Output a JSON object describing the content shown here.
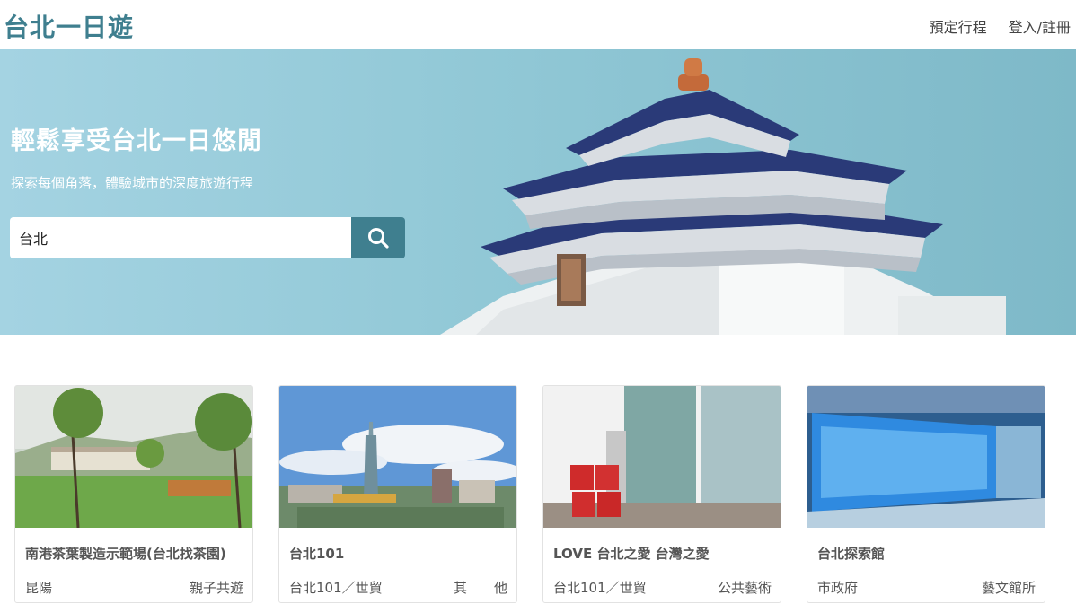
{
  "header": {
    "brand": "台北一日遊",
    "nav": {
      "booking": "預定行程",
      "login": "登入/註冊"
    }
  },
  "hero": {
    "title": "輕鬆享受台北一日悠閒",
    "subtitle": "探索每個角落，體驗城市的深度旅遊行程",
    "search": {
      "value": "台北",
      "icon": "search-icon"
    }
  },
  "cards": [
    {
      "title": "南港茶葉製造示範場(台北找茶園)",
      "location": "昆陽",
      "category": "親子共遊"
    },
    {
      "title": "台北101",
      "location": "台北101／世貿",
      "category": "其　　他"
    },
    {
      "title": "LOVE 台北之愛 台灣之愛",
      "location": "台北101／世貿",
      "category": "公共藝術"
    },
    {
      "title": "台北探索館",
      "location": "市政府",
      "category": "藝文館所"
    }
  ],
  "colors": {
    "brand": "#3f7f8f",
    "hero_bg": "#91c8d6"
  }
}
